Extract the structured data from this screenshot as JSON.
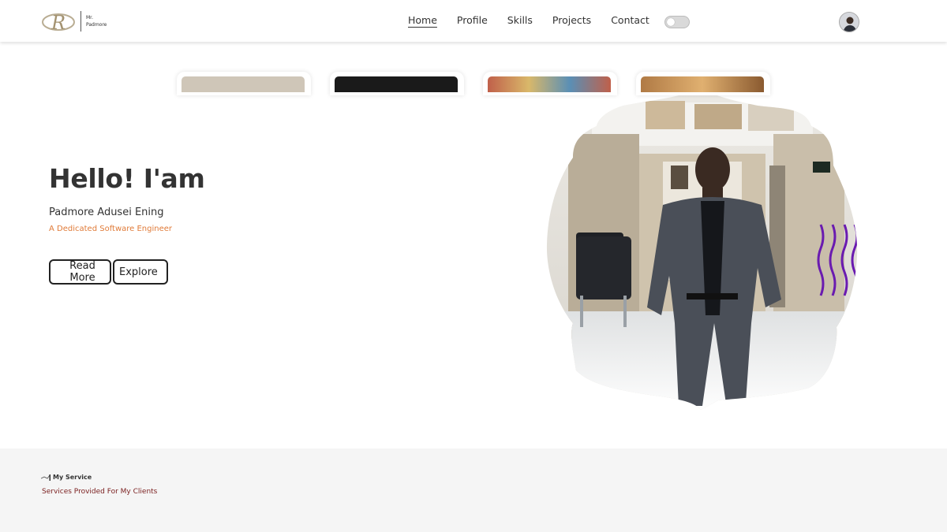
{
  "brand": {
    "line1": "Mr.",
    "line2": "Padmore"
  },
  "nav": {
    "items": [
      {
        "label": "Home",
        "active": true
      },
      {
        "label": "Profile",
        "active": false
      },
      {
        "label": "Skills",
        "active": false
      },
      {
        "label": "Projects",
        "active": false
      },
      {
        "label": "Contact",
        "active": false
      }
    ]
  },
  "theme_toggle": {
    "state": "off"
  },
  "hero": {
    "greeting": "Hello! I'am",
    "name": "Padmore Adusei Ening",
    "role": "A Dedicated Software Engineer",
    "buttons": {
      "read_more": "Read More",
      "explore": "Explore"
    }
  },
  "services": {
    "title": "My Service",
    "subtitle": "Services Provided For My Clients",
    "cards": [
      {
        "name": "service-card-1",
        "thumb_color": "#cfc6b8"
      },
      {
        "name": "service-card-2",
        "thumb_color": "#1a1a1a"
      },
      {
        "name": "service-card-3",
        "thumb_color": "#c0604a"
      },
      {
        "name": "service-card-4",
        "thumb_color": "#b07a45"
      }
    ]
  },
  "colors": {
    "accent": "#e07b39",
    "subtitle": "#7a1e1e",
    "text": "#333333"
  }
}
